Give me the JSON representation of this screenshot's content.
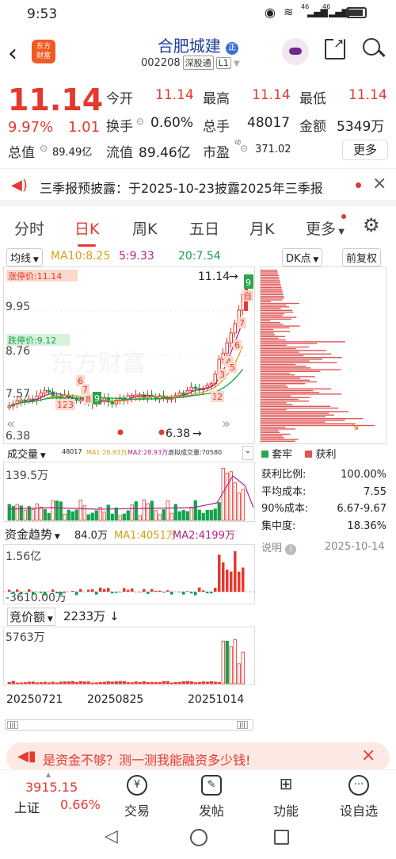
{
  "status": {
    "time": "9:53",
    "signal1": "46",
    "signal2": "46"
  },
  "header": {
    "logo_line1": "东方",
    "logo_line2": "财富",
    "title": "合肥城建",
    "title_badge": "正",
    "code": "002208",
    "market": "深股通",
    "level": "L1"
  },
  "quote": {
    "price": "11.14",
    "change_pct": "9.97%",
    "change": "1.01",
    "open_label": "今开",
    "open": "11.14",
    "high_label": "最高",
    "high": "11.14",
    "low_label": "最低",
    "low": "11.14",
    "turnover_label": "换手",
    "turnover": "0.60%",
    "volume_label": "总手",
    "volume": "48017",
    "amount_label": "金额",
    "amount": "5349万",
    "mcap_label": "总值",
    "mcap": "89.49亿",
    "float_label": "流值",
    "float": "89.46亿",
    "pe_label": "市盈",
    "pe_sup": "动",
    "pe": "371.02",
    "more": "更多"
  },
  "notice": {
    "text": "三季报预披露：于2025-10-23披露2025年三季报"
  },
  "tabs": [
    "分时",
    "日K",
    "周K",
    "五日",
    "月K",
    "更多"
  ],
  "chart_toolbar": {
    "ma_label": "均线",
    "ma10": "MA10:8.25",
    "ma5": "5:9.33",
    "ma20": "20:7.54",
    "dk": "DK点",
    "adjust": "前复权"
  },
  "kline": {
    "limit_up": "涨停价:11.14",
    "limit_down": "跌停价:9.12",
    "y_ticks": [
      "9.95",
      "8.76",
      "7.57",
      "6.38"
    ],
    "high_mark": "11.14",
    "low_mark": "6.38",
    "watermark": "东方财富",
    "badge_zi": "自",
    "badge_9": "9"
  },
  "volume_panel": {
    "label": "成交量",
    "value": "48017",
    "ma1": "MA1:28.93万",
    "ma2": "MA2:28.93万",
    "virtual": "虚拟成交量:70580",
    "max": "139.5万"
  },
  "funds_panel": {
    "label": "资金趋势",
    "value": "84.0万",
    "ma1": "MA1:4051万",
    "ma2": "MA2:4199万",
    "max": "1.56亿",
    "min": "-3610.00万"
  },
  "auction_panel": {
    "label": "竞价额",
    "value": "2233万",
    "max": "5763万"
  },
  "dates": [
    "20250721",
    "20250825",
    "20251014"
  ],
  "chip": {
    "legend_loss": "套牢",
    "legend_profit": "获利",
    "rows": [
      {
        "label": "获利比例:",
        "value": "100.00%"
      },
      {
        "label": "平均成本:",
        "value": "7.55"
      },
      {
        "label": "90%成本:",
        "value": "6.67-9.67"
      },
      {
        "label": "集中度:",
        "value": "18.36%"
      }
    ],
    "note": "说明",
    "date": "2025-10-14"
  },
  "banner": {
    "text": "是资金不够？测一测我能融资多少钱!"
  },
  "bottom": {
    "index_value": "3915.15",
    "index_name": "上证",
    "index_change": "0.66%",
    "items": [
      "交易",
      "发帖",
      "功能",
      "设自选"
    ]
  }
}
